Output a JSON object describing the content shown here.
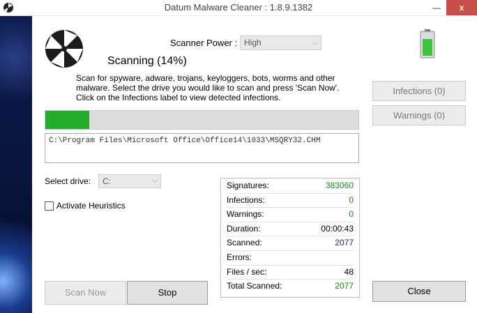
{
  "window": {
    "title": "Datum Malware Cleaner : 1.8.9.1382",
    "minimize_glyph": "—",
    "close_glyph": "x"
  },
  "header": {
    "status": "Scanning (14%)",
    "description": "Scan for spyware, adware, trojans, keyloggers, bots, worms and other malware. Select the drive you would like to scan and press 'Scan Now'. Click on the Infections label to view detected infections.",
    "scanner_power_label": "Scanner Power :",
    "scanner_power_value": "High"
  },
  "side": {
    "infections_button": "Infections (0)",
    "warnings_button": "Warnings (0)",
    "battery_level": 0.75
  },
  "progress": {
    "percent": 14,
    "current_file": "C:\\Program Files\\Microsoft Office\\Office14\\1033\\MSQRY32.CHM"
  },
  "drive": {
    "label": "Select drive:",
    "value": "C:"
  },
  "heuristics": {
    "label": "Activate Heuristics",
    "checked": false
  },
  "stats": [
    {
      "label": "Signatures:",
      "value": "383060",
      "color": "#1a8a1a"
    },
    {
      "label": "Infections:",
      "value": "0",
      "color": "#1a8a1a"
    },
    {
      "label": "Warnings:",
      "value": "0",
      "color": "#1a8a1a"
    },
    {
      "label": "Duration:",
      "value": "00:00:43",
      "color": "#000000"
    },
    {
      "label": "Scanned:",
      "value": "2077",
      "color": "#1c2a8c"
    },
    {
      "label": "Errors:",
      "value": "",
      "color": "#000000"
    },
    {
      "label": "Files / sec:",
      "value": "48",
      "color": "#000000"
    },
    {
      "label": "Total Scanned:",
      "value": "2077",
      "color": "#1a8a1a"
    }
  ],
  "buttons": {
    "scan_now": "Scan Now",
    "stop": "Stop",
    "close": "Close"
  },
  "colors": {
    "progress_fill": "#23ae2a",
    "title_close": "#c7504a"
  }
}
